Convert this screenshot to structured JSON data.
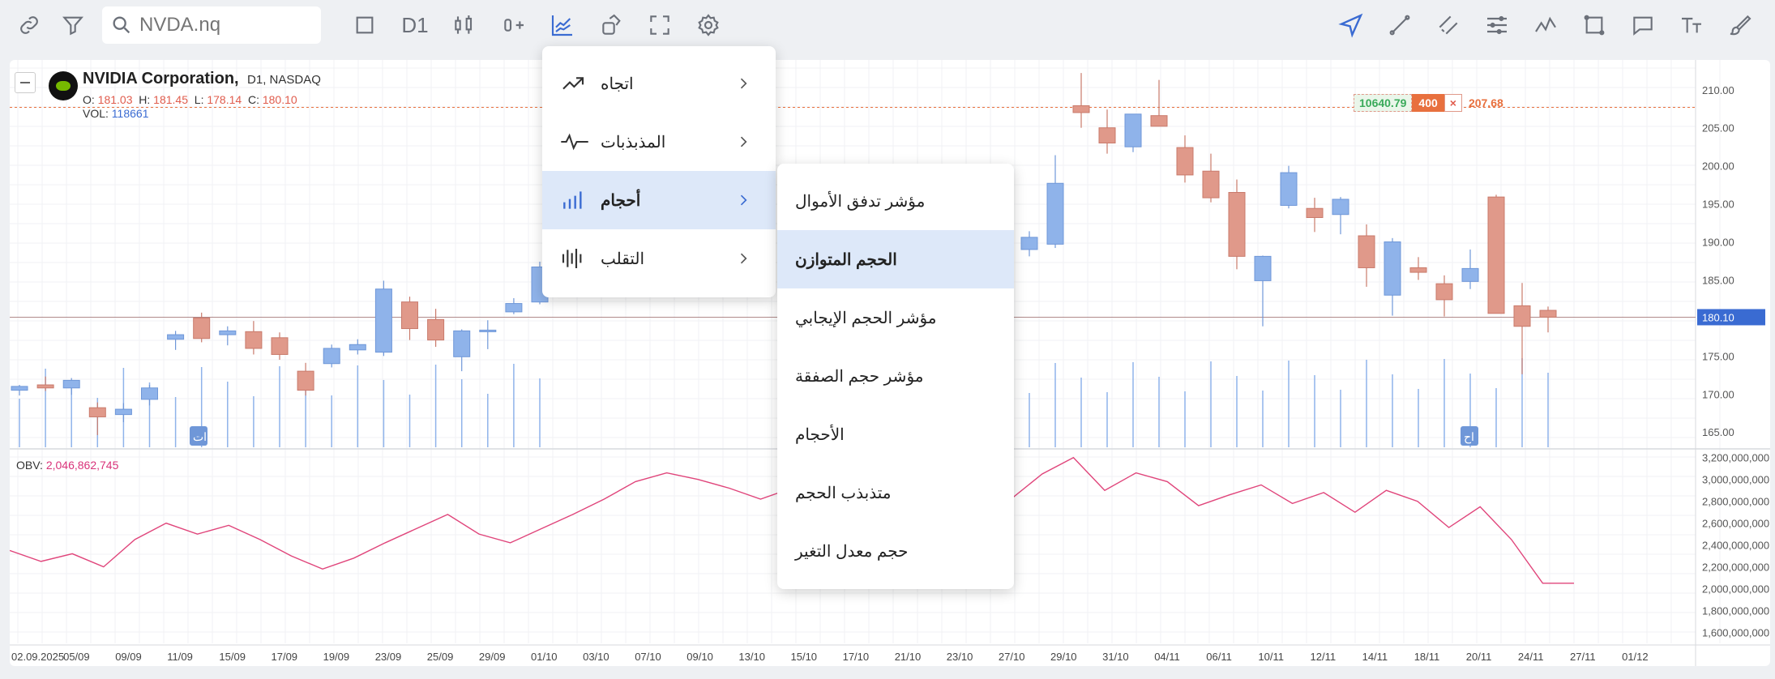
{
  "toolbar": {
    "search_placeholder": "NVDA.nq",
    "timeframe": "D1"
  },
  "legend": {
    "company": "NVIDIA Corporation,",
    "meta": "D1, NASDAQ",
    "o_label": "O:",
    "o": "181.03",
    "h_label": "H:",
    "h": "181.45",
    "l_label": "L:",
    "l": "178.14",
    "c_label": "C:",
    "c": "180.10",
    "vol_label": "VOL:",
    "vol": "118661",
    "obv_label": "OBV:",
    "obv": "2,046,862,745"
  },
  "order_tag": {
    "price": "10640.79",
    "qty": "400",
    "close": "×",
    "level": "207.68"
  },
  "last_price": "180.10",
  "price_axis": [
    "210.00",
    "205.00",
    "200.00",
    "195.00",
    "190.00",
    "185.00",
    "175.00",
    "170.00",
    "165.00"
  ],
  "obv_axis": [
    "3,200,000,000",
    "3,000,000,000",
    "2,800,000,000",
    "2,600,000,000",
    "2,400,000,000",
    "2,200,000,000",
    "2,000,000,000",
    "1,800,000,000",
    "1,600,000,000"
  ],
  "date_axis": [
    "02.09.2025",
    "05/09",
    "09/09",
    "11/09",
    "15/09",
    "17/09",
    "19/09",
    "23/09",
    "25/09",
    "29/09",
    "01/10",
    "03/10",
    "07/10",
    "09/10",
    "13/10",
    "15/10",
    "17/10",
    "21/10",
    "23/10",
    "27/10",
    "29/10",
    "31/10",
    "04/11",
    "06/11",
    "10/11",
    "12/11",
    "14/11",
    "18/11",
    "20/11",
    "24/11",
    "27/11",
    "01/12"
  ],
  "markers": [
    "ات",
    "اح"
  ],
  "menu": [
    {
      "label": "اتجاه",
      "icon": "trend-icon"
    },
    {
      "label": "المذبذبات",
      "icon": "oscillator-icon"
    },
    {
      "label": "أحجام",
      "icon": "volume-bars-icon"
    },
    {
      "label": "التقلب",
      "icon": "volatility-icon"
    }
  ],
  "submenu": [
    "مؤشر تدفق الأموال",
    "الحجم المتوازن",
    "مؤشر الحجم الإيجابي",
    "مؤشر حجم الصفقة",
    "الأحجام",
    "متذبذب الحجم",
    "حجم معدل التغير"
  ],
  "colors": {
    "up": "#8fb3ea",
    "down": "#e0998a",
    "obv_line": "#e0457b",
    "accent": "#3a6bd2"
  },
  "chart_data": {
    "type": "candlestick",
    "x": [
      "02.09.2025",
      "03/09",
      "04/09",
      "05/09",
      "08/09",
      "09/09",
      "10/09",
      "11/09",
      "12/09",
      "15/09",
      "16/09",
      "17/09",
      "18/09",
      "19/09",
      "22/09",
      "23/09",
      "24/09",
      "25/09",
      "26/09",
      "29/09",
      "30/09",
      "27/10",
      "28/10",
      "29/10",
      "30/10",
      "31/10",
      "03/11",
      "04/11",
      "05/11",
      "06/11",
      "07/11",
      "10/11",
      "11/11",
      "12/11",
      "13/11",
      "14/11",
      "17/11",
      "18/11",
      "19/11",
      "20/11",
      "21/11",
      "24/11"
    ],
    "candles": [
      [
        170.5,
        171.2,
        169.8,
        171.0
      ],
      [
        171.2,
        172.3,
        170.4,
        170.8
      ],
      [
        170.8,
        172.1,
        169.9,
        171.8
      ],
      [
        168.2,
        168.9,
        164.6,
        167.0
      ],
      [
        167.3,
        168.8,
        166.3,
        168.0
      ],
      [
        169.3,
        171.2,
        168.5,
        170.8
      ],
      [
        177.2,
        178.3,
        175.8,
        177.8
      ],
      [
        180.0,
        180.7,
        176.8,
        177.3
      ],
      [
        177.8,
        178.9,
        176.4,
        178.3
      ],
      [
        178.2,
        179.6,
        175.2,
        176.0
      ],
      [
        177.4,
        178.1,
        174.5,
        175.2
      ],
      [
        173.0,
        174.1,
        169.8,
        170.5
      ],
      [
        174.0,
        176.5,
        173.5,
        176.0
      ],
      [
        175.8,
        177.2,
        175.2,
        176.5
      ],
      [
        175.5,
        184.9,
        175.0,
        183.8
      ],
      [
        182.1,
        182.8,
        177.1,
        178.6
      ],
      [
        179.8,
        181.2,
        176.2,
        177.1
      ],
      [
        174.9,
        178.5,
        173.0,
        178.3
      ],
      [
        178.2,
        179.7,
        175.9,
        178.4
      ],
      [
        180.8,
        182.6,
        180.5,
        181.9
      ],
      [
        182.1,
        187.4,
        181.8,
        186.7
      ],
      [
        189.0,
        191.4,
        188.1,
        190.6
      ],
      [
        189.7,
        201.4,
        189.2,
        197.7
      ],
      [
        207.9,
        212.2,
        205.0,
        207.0
      ],
      [
        205.0,
        207.4,
        201.6,
        203.0
      ],
      [
        202.5,
        206.2,
        201.8,
        206.8
      ],
      [
        206.6,
        211.3,
        205.6,
        205.2
      ],
      [
        202.4,
        204.0,
        197.8,
        198.8
      ],
      [
        199.3,
        201.6,
        195.2,
        195.8
      ],
      [
        196.5,
        198.2,
        186.4,
        188.1
      ],
      [
        184.9,
        188.2,
        178.9,
        188.1
      ],
      [
        194.8,
        200.0,
        194.4,
        199.1
      ],
      [
        194.4,
        195.8,
        191.3,
        193.2
      ],
      [
        193.6,
        195.9,
        191.0,
        195.6
      ],
      [
        190.8,
        192.3,
        184.1,
        186.6
      ],
      [
        183.0,
        190.5,
        180.3,
        190.0
      ],
      [
        186.6,
        188.0,
        185.0,
        186.0
      ],
      [
        184.5,
        185.6,
        180.2,
        182.4
      ],
      [
        184.8,
        189.0,
        183.8,
        186.5
      ],
      [
        195.9,
        196.2,
        180.6,
        180.6
      ],
      [
        181.6,
        184.6,
        172.6,
        178.9
      ],
      [
        181.0,
        181.5,
        178.1,
        180.1
      ]
    ],
    "obv": [
      2.35,
      2.25,
      2.32,
      2.2,
      2.45,
      2.6,
      2.5,
      2.58,
      2.45,
      2.3,
      2.18,
      2.28,
      2.42,
      2.55,
      2.68,
      2.5,
      2.42,
      2.55,
      2.68,
      2.82,
      2.98,
      3.06,
      3.0,
      2.92,
      2.82,
      2.92,
      2.8,
      2.85,
      2.82,
      2.65,
      2.88,
      2.98,
      2.82,
      3.05,
      3.2,
      2.9,
      3.06,
      2.98,
      2.76,
      2.86,
      2.95,
      2.78,
      2.88,
      2.7,
      2.9,
      2.8,
      2.56,
      2.75,
      2.45,
      2.05,
      2.05
    ],
    "price_range": [
      163,
      212
    ],
    "obv_range": [
      1.5,
      3.25
    ]
  }
}
